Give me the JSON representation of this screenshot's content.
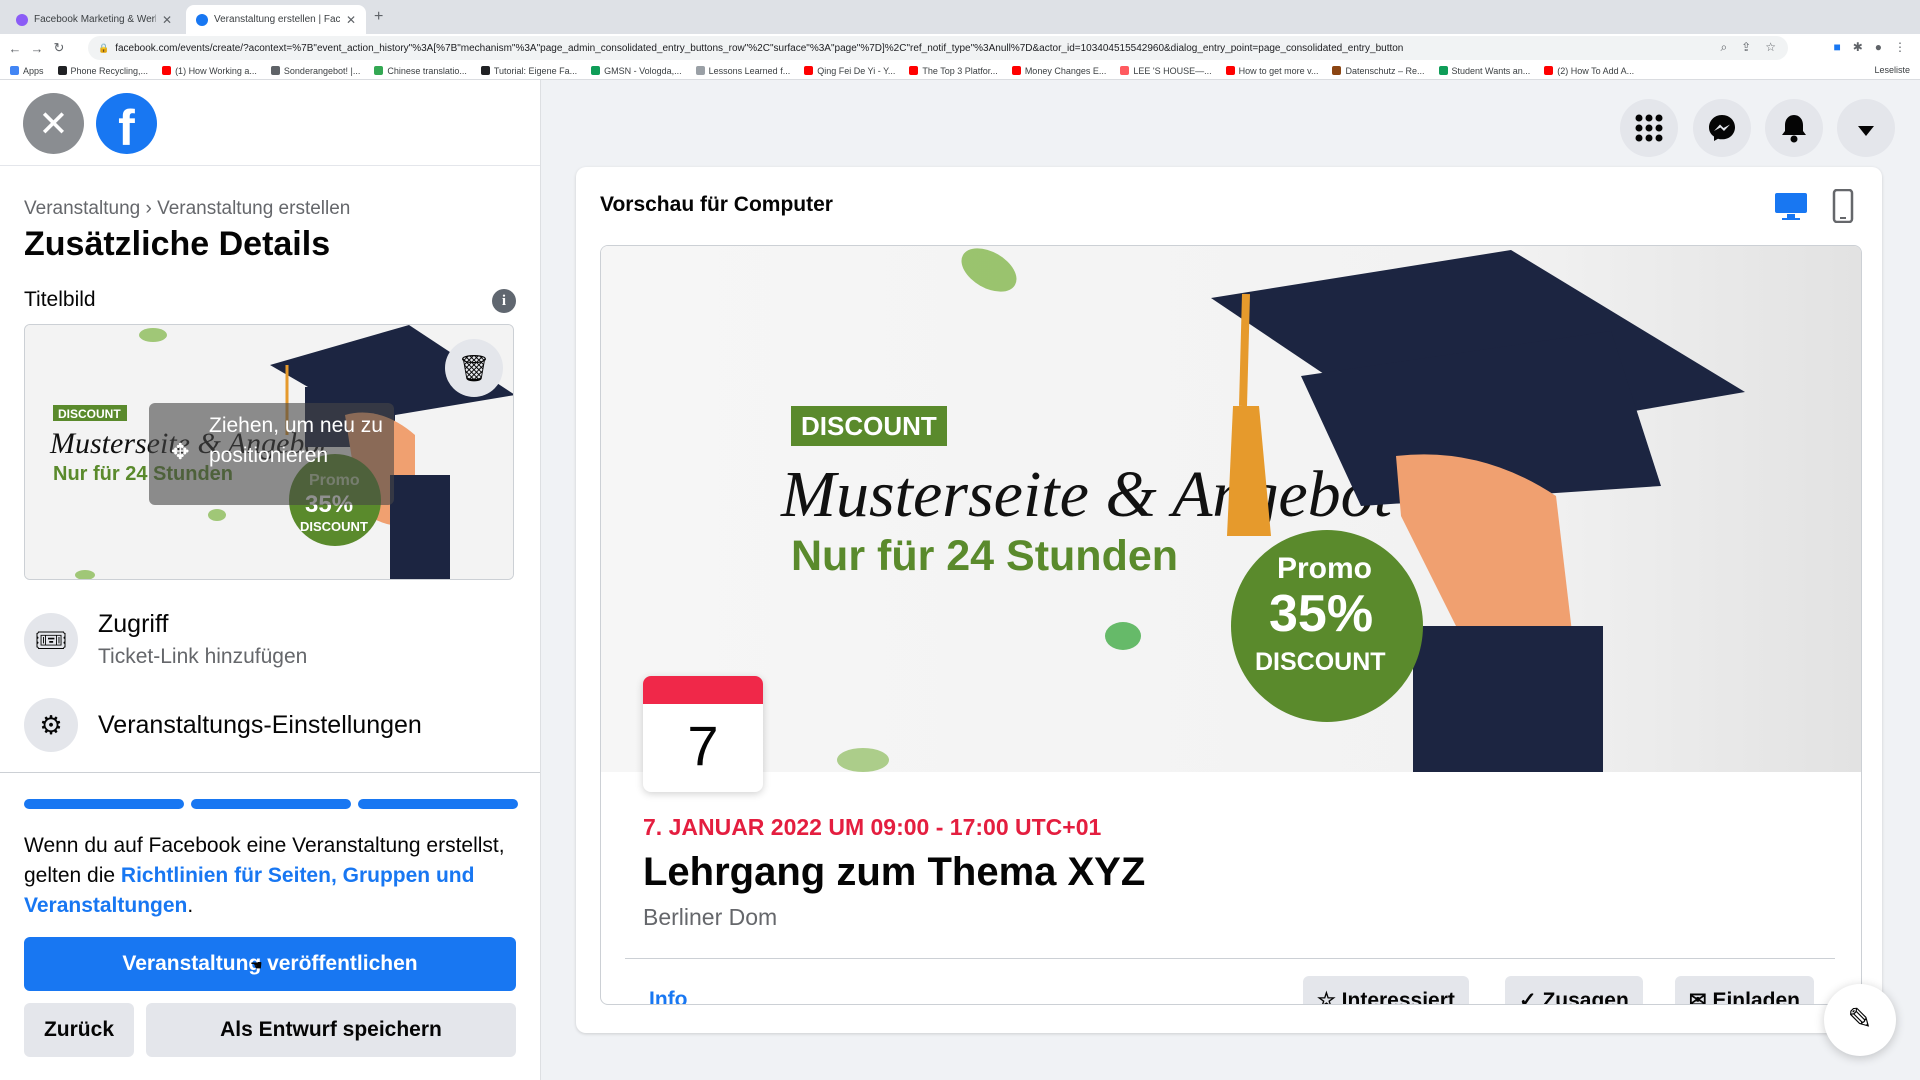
{
  "browser": {
    "tabs": [
      {
        "title": "Facebook Marketing & Werbe...",
        "active": false
      },
      {
        "title": "Veranstaltung erstellen | Faceb...",
        "active": true
      }
    ],
    "url": "facebook.com/events/create/?acontext=%7B\"event_action_history\"%3A[%7B\"mechanism\"%3A\"page_admin_consolidated_entry_buttons_row\"%2C\"surface\"%3A\"page\"%7D]%2C\"ref_notif_type\"%3Anull%7D&actor_id=103404515542960&dialog_entry_point=page_consolidated_entry_button",
    "bookmarks": [
      "Apps",
      "Phone Recycling,...",
      "(1) How Working a...",
      "Sonderangebot! |...",
      "Chinese translatio...",
      "Tutorial: Eigene Fa...",
      "GMSN - Vologda,...",
      "Lessons Learned f...",
      "Qing Fei De Yi - Y...",
      "The Top 3 Platfor...",
      "Money Changes E...",
      "LEE 'S HOUSE—...",
      "How to get more v...",
      "Datenschutz – Re...",
      "Student Wants an...",
      "(2) How To Add A..."
    ],
    "reading_list": "Leseliste"
  },
  "sidebar": {
    "breadcrumb": "Veranstaltung › Veranstaltung erstellen",
    "title": "Zusätzliche Details",
    "cover_label": "Titelbild",
    "drag_hint": "Ziehen, um neu zu positionieren",
    "options": [
      {
        "title": "Zugriff",
        "subtitle": "Ticket-Link hinzufügen",
        "icon": "ticket-icon"
      },
      {
        "title": "Veranstaltungs-Einstellungen",
        "subtitle": "",
        "icon": "gear-icon"
      }
    ],
    "progress_steps": 3,
    "terms_prefix": "Wenn du auf Facebook eine Veranstaltung erstellst, gelten die ",
    "terms_link": "Richtlinien für Seiten, Gruppen und Veranstaltungen",
    "terms_suffix": ".",
    "publish_label": "Veranstaltung veröffentlichen",
    "back_label": "Zurück",
    "draft_label": "Als Entwurf speichern"
  },
  "preview": {
    "title": "Vorschau für Computer",
    "cover": {
      "badge": "DISCOUNT",
      "headline": "Musterseite & Angebot",
      "subline": "Nur für 24 Stunden",
      "promo_word": "Promo",
      "promo_percent": "35%",
      "promo_discount": "DISCOUNT"
    },
    "date_day": "7",
    "event_date": "7. JANUAR 2022 UM 09:00 - 17:00 UTC+01",
    "event_title": "Lehrgang zum Thema XYZ",
    "event_place": "Berliner Dom",
    "tab_info": "Info",
    "buttons": {
      "interested": "Interessiert",
      "going": "Zusagen",
      "invite": "Einladen"
    }
  },
  "colors": {
    "facebook_blue": "#1877f2",
    "date_red": "#e41e3f",
    "promo_green": "#5a8a2c",
    "cap_navy": "#1c2541"
  }
}
